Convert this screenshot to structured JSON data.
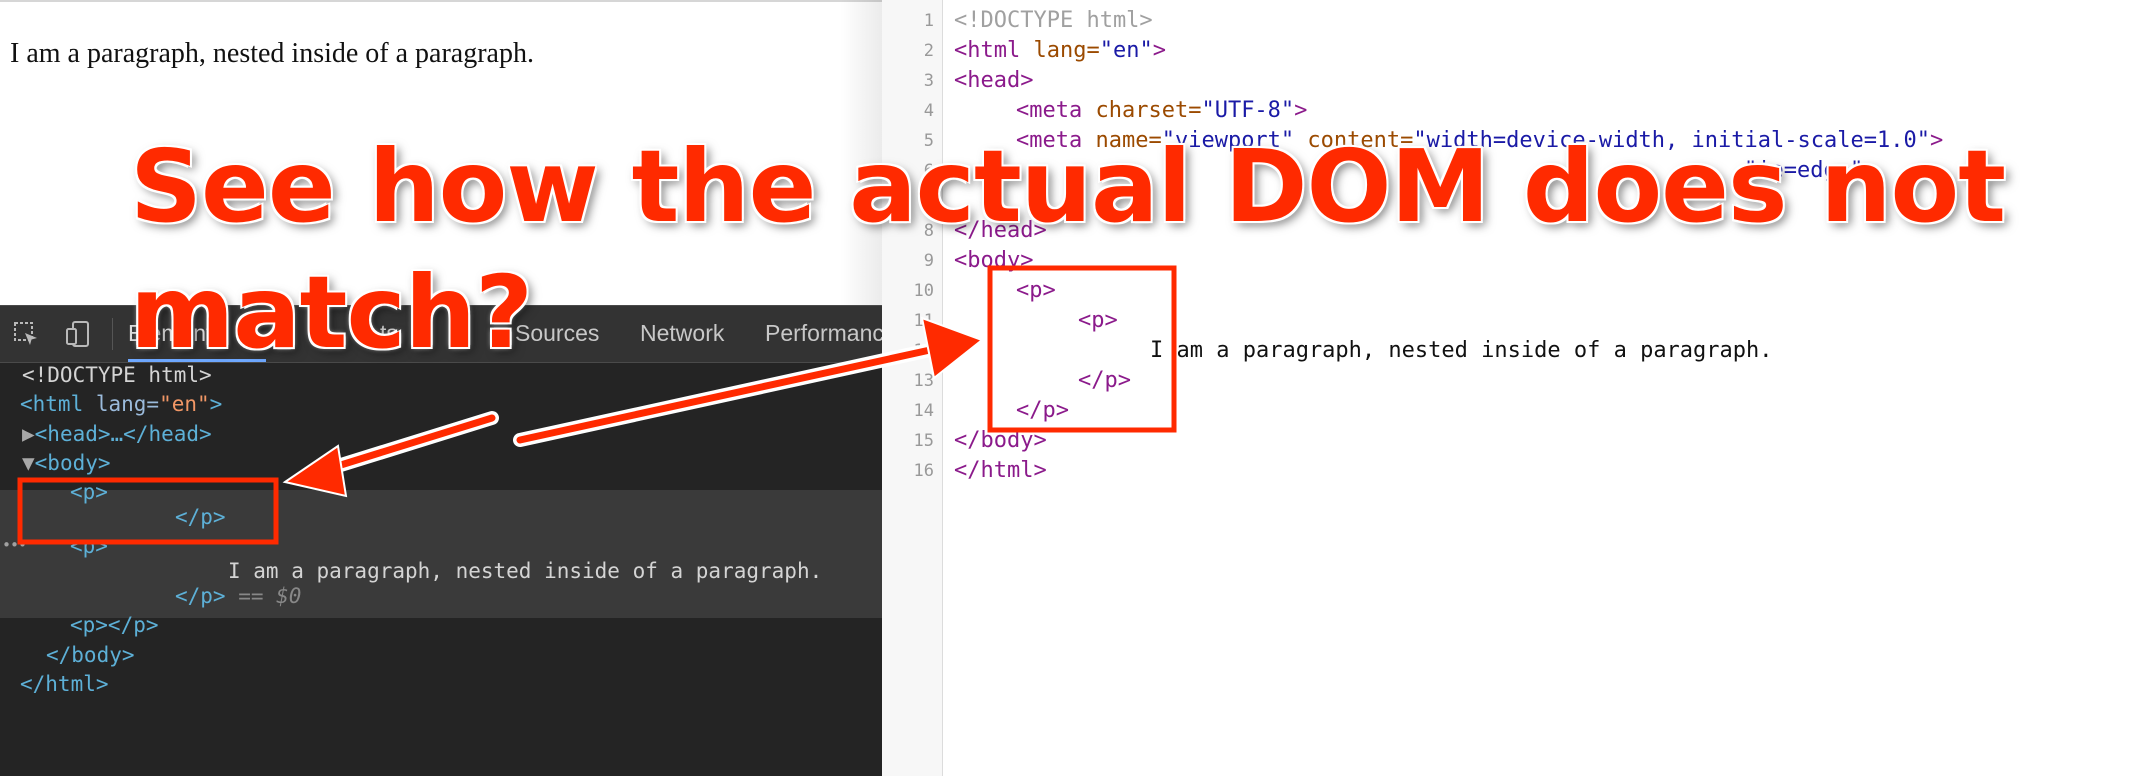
{
  "rendered_page": {
    "paragraph": "I am a paragraph, nested inside of a paragraph."
  },
  "devtools": {
    "tabs": [
      {
        "label": "Elements"
      },
      {
        "label": "Console"
      },
      {
        "label": "Sources"
      },
      {
        "label": "Network"
      },
      {
        "label": "Performance"
      }
    ],
    "tabs_visible_fragments": {
      "console": "ts"
    },
    "elements_tree": {
      "doctype": "<!DOCTYPE html>",
      "html_open_tag": "<html",
      "html_lang_attr": " lang=",
      "html_lang_val": "\"en\"",
      "html_open_close": ">",
      "head_collapsed": "<head>…</head>",
      "body_open": "<body>",
      "p1_open": "<p>",
      "p1_close": "</p>",
      "p2_open": "<p>",
      "p2_text": "I am a paragraph, nested inside of a paragraph.",
      "p2_close": "</p>",
      "p2_selected_marker": "== $0",
      "p3": "<p></p>",
      "body_close": "</body>",
      "html_close": "</html>"
    },
    "ellipsis": "•••"
  },
  "source": {
    "line_numbers": [
      "1",
      "2",
      "3",
      "4",
      "5",
      "6",
      "7",
      "8",
      "9",
      "10",
      "11",
      "12",
      "13",
      "14",
      "15",
      "16"
    ],
    "lines": {
      "l1": "<!DOCTYPE html>",
      "l2_tag": "<html ",
      "l2_attr": "lang=",
      "l2_val": "\"en\"",
      "l2_end": ">",
      "l3": "<head>",
      "l4_tag": "<meta ",
      "l4_attr": "charset=",
      "l4_val": "\"UTF-8\"",
      "l4_end": ">",
      "l5_tag": "<meta ",
      "l5_attr1": "name=",
      "l5_val1": "\"viewport\"",
      "l5_attr2": " content=",
      "l5_val2": "\"width=device-width, initial-scale=1.0\"",
      "l5_end": ">",
      "l6_val": "\"ie=edge\"",
      "l6_end": ">",
      "l8": "</head>",
      "l9": "<body>",
      "l10": "<p>",
      "l11": "<p>",
      "l12": "I am a paragraph, nested inside of a paragraph.",
      "l13": "</p>",
      "l14": "</p>",
      "l15": "</body>",
      "l16": "</html>"
    }
  },
  "annotation": {
    "callout_line1": "See how the actual DOM does not",
    "callout_line2": "match?",
    "color": "#ff2a00"
  },
  "colors": {
    "devtools_bg": "#242424",
    "devtools_tag": "#5db0d7",
    "source_tag": "#8b1a8b",
    "source_attr": "#9b4a00",
    "source_val": "#1a1aa6"
  }
}
